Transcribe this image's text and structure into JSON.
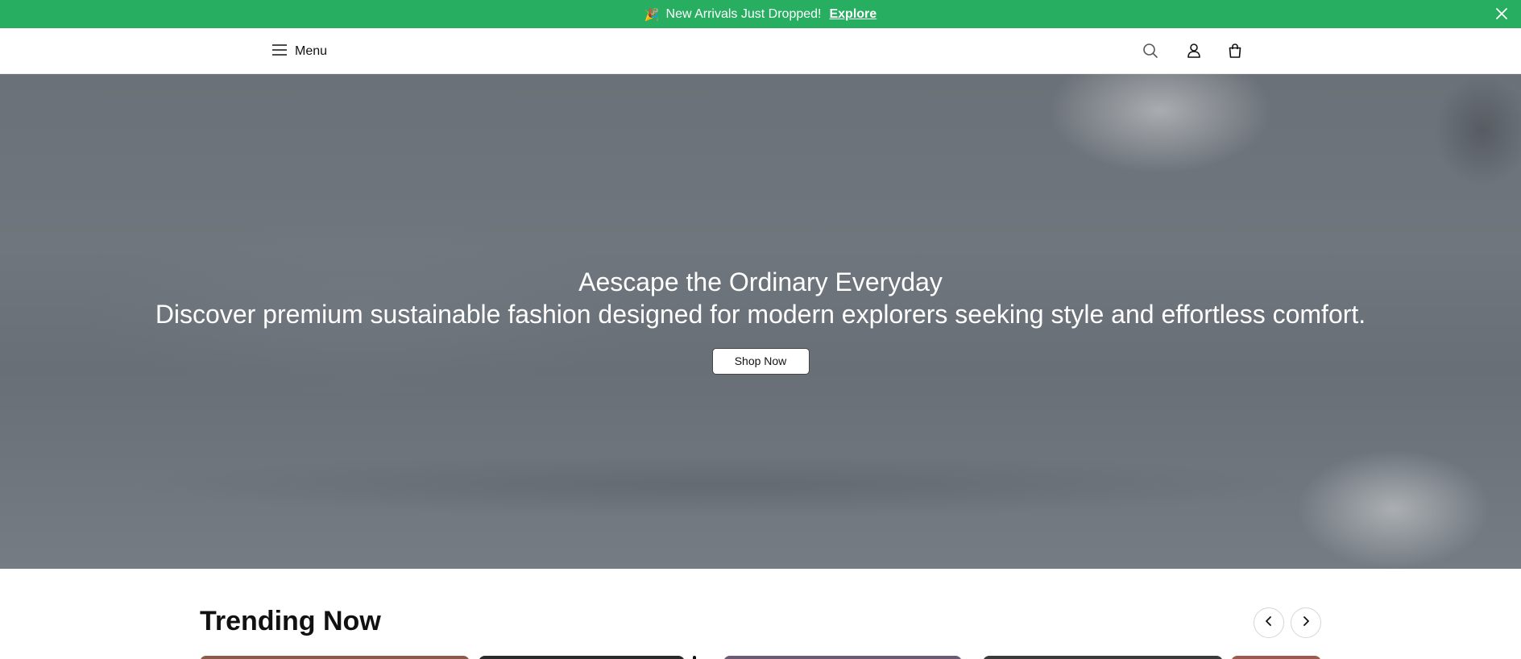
{
  "announcement": {
    "emoji": "🎉",
    "message": "New Arrivals Just Dropped!",
    "link_label": "Explore",
    "close_icon": "close-icon",
    "background": "#27ae60"
  },
  "header": {
    "menu_label": "Menu",
    "icons": [
      "menu-icon",
      "search-icon",
      "user-icon",
      "bag-icon"
    ]
  },
  "hero": {
    "title": "Aescape the Ordinary Everyday",
    "subtitle": "Discover premium sustainable fashion designed for modern explorers seeking style and effortless comfort.",
    "cta_label": "Shop Now"
  },
  "trending": {
    "title": "Trending Now",
    "prev_icon": "chevron-left-icon",
    "next_icon": "chevron-right-icon"
  }
}
